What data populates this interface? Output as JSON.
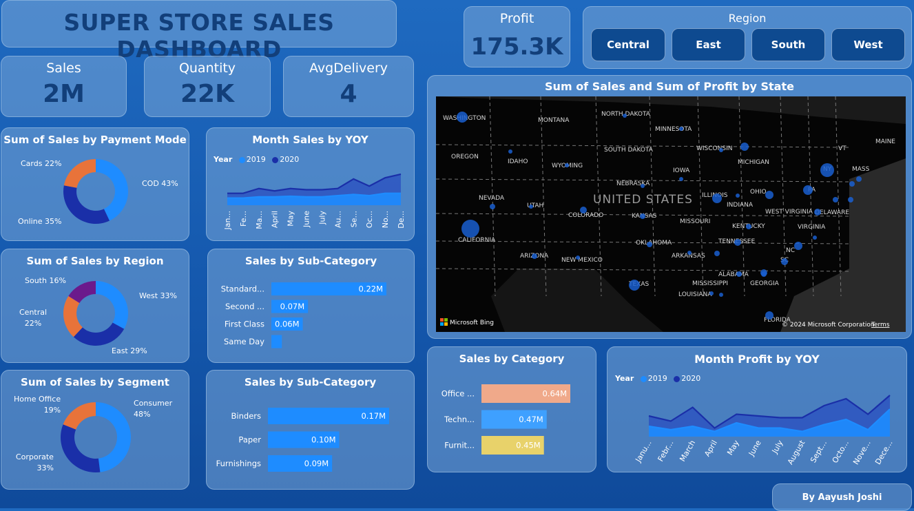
{
  "title": "SUPER STORE SALES DASHBOARD",
  "kpis": {
    "profit": {
      "label": "Profit",
      "value": "175.3K"
    },
    "sales": {
      "label": "Sales",
      "value": "2M"
    },
    "quantity": {
      "label": "Quantity",
      "value": "22K"
    },
    "avg_delivery": {
      "label": "AvgDelivery",
      "value": "4"
    }
  },
  "region_filter": {
    "title": "Region",
    "options": [
      "Central",
      "East",
      "South",
      "West"
    ]
  },
  "colors": {
    "blue_light": "#1e8cff",
    "blue_dark": "#1a2fa8",
    "orange": "#e8733a",
    "purple": "#6b1a8c",
    "salmon": "#f0a98a",
    "yellow": "#e8d26a"
  },
  "map": {
    "title": "Sum of Sales and Sum of Profit by State",
    "country_label": "UNITED STATES",
    "attribution": "Microsoft Bing",
    "copyright": "© 2024 Microsoft Corporation",
    "terms": "Terms",
    "state_labels": [
      "WASHINGTON",
      "MONTANA",
      "NORTH DAKOTA",
      "MINNESOTA",
      "OREGON",
      "IDAHO",
      "WYOMING",
      "SOUTH DAKOTA",
      "WISCONSIN",
      "MICHIGAN",
      "IOWA",
      "NEBRASKA",
      "NEVADA",
      "UTAH",
      "COLORADO",
      "KANSAS",
      "ILLINOIS",
      "INDIANA",
      "OHIO",
      "PA",
      "NY",
      "CALIFORNIA",
      "MISSOURI",
      "KENTUCKY",
      "WEST VIRGINIA",
      "VIRGINIA",
      "DELAWARE",
      "ARIZONA",
      "NEW MEXICO",
      "OKLAHOMA",
      "TENNESSEE",
      "NC",
      "ARKANSAS",
      "SC",
      "MISSISSIPPI",
      "ALABAMA",
      "GEORGIA",
      "TEXAS",
      "LOUISIANA",
      "FLORIDA",
      "VT",
      "MASS",
      "MAINE"
    ]
  },
  "chart_data": [
    {
      "id": "payment",
      "type": "pie",
      "title": "Sum of Sales by Payment Mode",
      "categories": [
        "COD",
        "Online",
        "Cards"
      ],
      "values": [
        43,
        35,
        22
      ],
      "labels": [
        "COD 43%",
        "Online 35%",
        "Cards 22%"
      ],
      "colors": [
        "#1e8cff",
        "#1a2fa8",
        "#e8733a"
      ]
    },
    {
      "id": "month_sales",
      "type": "area",
      "title": "Month Sales by YOY",
      "legend_title": "Year",
      "categories": [
        "Jan...",
        "Fe...",
        "Ma...",
        "April",
        "May",
        "June",
        "July",
        "Au...",
        "Se...",
        "Oc...",
        "No...",
        "De..."
      ],
      "series": [
        {
          "name": "2019",
          "values": [
            0.06,
            0.06,
            0.07,
            0.07,
            0.075,
            0.07,
            0.07,
            0.08,
            0.09,
            0.08,
            0.1,
            0.1
          ]
        },
        {
          "name": "2020",
          "values": [
            0.1,
            0.1,
            0.14,
            0.12,
            0.14,
            0.13,
            0.13,
            0.14,
            0.22,
            0.16,
            0.23,
            0.26
          ]
        }
      ],
      "ylim": [
        0,
        0.3
      ]
    },
    {
      "id": "region",
      "type": "pie",
      "title": "Sum of Sales by Region",
      "categories": [
        "West",
        "East",
        "Central",
        "South"
      ],
      "values": [
        33,
        29,
        22,
        16
      ],
      "labels": [
        "West 33%",
        "East 29%",
        "Central\n22%",
        "South 16%"
      ],
      "colors": [
        "#1e8cff",
        "#1a2fa8",
        "#e8733a",
        "#6b1a8c"
      ]
    },
    {
      "id": "subcat_ship",
      "type": "bar",
      "title": "Sales by Sub-Category",
      "categories": [
        "Standard...",
        "Second ...",
        "First Class",
        "Same Day"
      ],
      "values": [
        0.22,
        0.07,
        0.06,
        0.02
      ],
      "value_labels": [
        "0.22M",
        "0.07M",
        "0.06M",
        ""
      ],
      "xlim": [
        0,
        0.22
      ]
    },
    {
      "id": "segment",
      "type": "pie",
      "title": "Sum of Sales by Segment",
      "categories": [
        "Consumer",
        "Corporate",
        "Home Office"
      ],
      "values": [
        48,
        33,
        19
      ],
      "labels": [
        "Consumer\n48%",
        "Corporate\n33%",
        "Home Office\n19%"
      ],
      "colors": [
        "#1e8cff",
        "#1a2fa8",
        "#e8733a"
      ]
    },
    {
      "id": "subcat_items",
      "type": "bar",
      "title": "Sales by Sub-Category",
      "categories": [
        "Binders",
        "Paper",
        "Furnishings"
      ],
      "values": [
        0.17,
        0.1,
        0.09
      ],
      "value_labels": [
        "0.17M",
        "0.10M",
        "0.09M"
      ],
      "xlim": [
        0,
        0.17
      ]
    },
    {
      "id": "category",
      "type": "bar",
      "title": "Sales by Category",
      "categories": [
        "Office ...",
        "Techn...",
        "Furnit..."
      ],
      "values": [
        0.64,
        0.47,
        0.45
      ],
      "value_labels": [
        "0.64M",
        "0.47M",
        "0.45M"
      ],
      "colors": [
        "#f0a98a",
        "#3ea0ff",
        "#e8d26a"
      ],
      "xlim": [
        0,
        0.64
      ]
    },
    {
      "id": "month_profit",
      "type": "area",
      "title": "Month Profit by YOY",
      "legend_title": "Year",
      "categories": [
        "Janu...",
        "Febr...",
        "March",
        "April",
        "May",
        "June",
        "July",
        "August",
        "Sept...",
        "Octo...",
        "Nove...",
        "Dece..."
      ],
      "series": [
        {
          "name": "2019",
          "values": [
            6,
            4,
            6,
            3,
            8,
            5,
            5,
            3,
            7,
            10,
            4,
            16
          ]
        },
        {
          "name": "2020",
          "values": [
            12,
            9,
            17,
            5,
            13,
            12,
            11,
            11,
            18,
            22,
            13,
            24
          ]
        }
      ],
      "ylim": [
        0,
        30
      ]
    }
  ],
  "footer": {
    "author": "By Aayush Joshi"
  }
}
